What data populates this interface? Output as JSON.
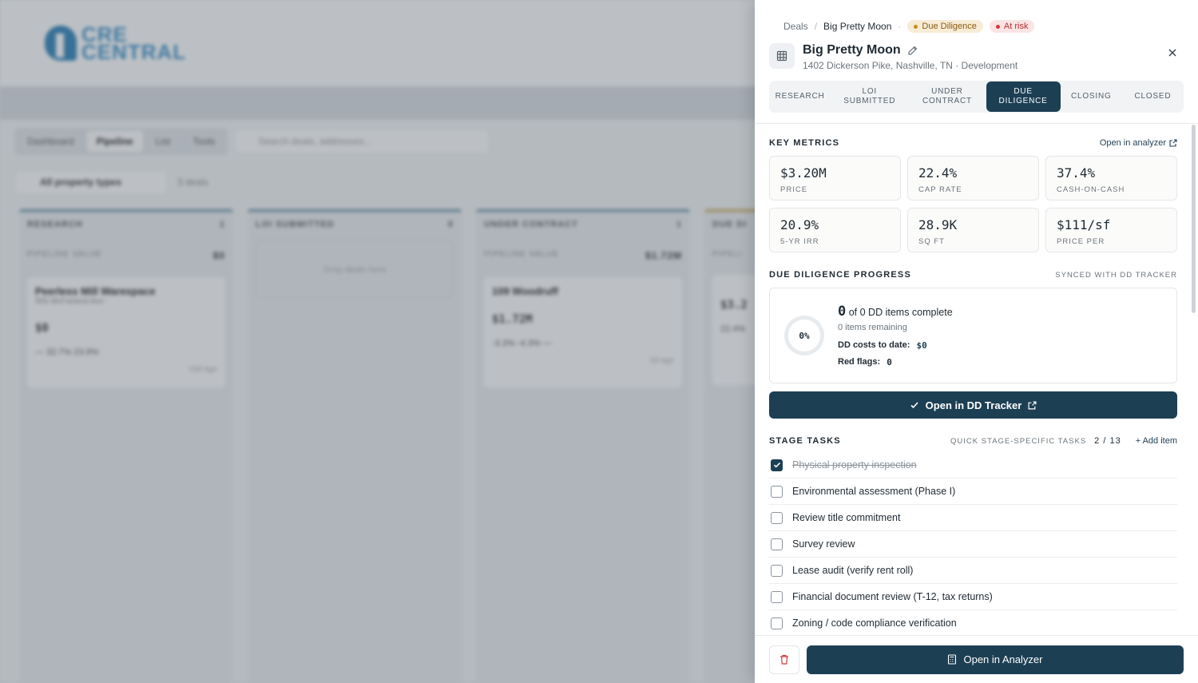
{
  "background": {
    "logo": {
      "line1": "CRE",
      "line2": "CENTRAL"
    },
    "view_tabs": [
      "Dashboard",
      "Pipeline",
      "List",
      "Tools"
    ],
    "active_view": "Pipeline",
    "search_placeholder": "Search deals, addresses...",
    "filter_label": "All property types",
    "deal_count": "3 deals",
    "columns": [
      {
        "name": "RESEARCH",
        "count": "1",
        "value_label": "PIPELINE VALUE",
        "value": "$0",
        "card": {
          "name": "Peerless Mill Warespace",
          "address": "555 McFarland Ave",
          "price": "$0",
          "metrics": "—   32.7%   23.9%",
          "age": "13d ago"
        }
      },
      {
        "name": "LOI SUBMITTED",
        "count": "0",
        "drop_text": "Drop deals here"
      },
      {
        "name": "UNDER CONTRACT",
        "count": "1",
        "value_label": "PIPELINE VALUE",
        "value": "$1.72M",
        "card": {
          "name": "109 Woodruff",
          "address": "",
          "price": "$1.72M",
          "metrics": "-3.3%   -4.3%   —",
          "age": "2d ago"
        }
      },
      {
        "name": "DUE DI",
        "count": "",
        "value_label": "PIPELI",
        "value": "",
        "card": {
          "name": "",
          "address": "",
          "price": "$3.2",
          "metrics": "22.4%",
          "age": ""
        }
      }
    ]
  },
  "drawer": {
    "breadcrumb": {
      "root": "Deals",
      "current": "Big Pretty Moon"
    },
    "badges": {
      "stage": "Due Diligence",
      "risk": "At risk"
    },
    "title": "Big Pretty Moon",
    "subtitle": "1402 Dickerson Pike, Nashville, TN · Development",
    "stages": [
      {
        "label": "RESEARCH",
        "active": false
      },
      {
        "label": "LOI SUBMITTED",
        "active": false
      },
      {
        "label": "UNDER CONTRACT",
        "active": false
      },
      {
        "label": "DUE DILIGENCE",
        "active": true
      },
      {
        "label": "CLOSING",
        "active": false
      },
      {
        "label": "CLOSED",
        "active": false
      }
    ],
    "key_metrics": {
      "title": "KEY METRICS",
      "link": "Open in analyzer",
      "items": [
        {
          "value": "$3.20M",
          "label": "PRICE"
        },
        {
          "value": "22.4%",
          "label": "CAP RATE"
        },
        {
          "value": "37.4%",
          "label": "CASH-ON-CASH"
        },
        {
          "value": "20.9%",
          "label": "5-YR IRR"
        },
        {
          "value": "28.9K",
          "label": "SQ FT"
        },
        {
          "value": "$111/sf",
          "label": "PRICE PER"
        }
      ]
    },
    "dd_progress": {
      "title": "DUE DILIGENCE PROGRESS",
      "sync": "SYNCED WITH DD TRACKER",
      "percent": "0%",
      "complete_num": "0",
      "complete_text": "of 0 DD items complete",
      "remaining": "0 items remaining",
      "costs_label": "DD costs to date:",
      "costs_value": "$0",
      "flags_label": "Red flags:",
      "flags_value": "0",
      "button": "Open in DD Tracker"
    },
    "stage_tasks": {
      "title": "STAGE TASKS",
      "subtitle": "QUICK STAGE-SPECIFIC TASKS",
      "count": "2 / 13",
      "add": "+ Add item",
      "items": [
        {
          "label": "Physical property inspection",
          "done": true
        },
        {
          "label": "Environmental assessment (Phase I)",
          "done": false
        },
        {
          "label": "Review title commitment",
          "done": false
        },
        {
          "label": "Survey review",
          "done": false
        },
        {
          "label": "Lease audit (verify rent roll)",
          "done": false
        },
        {
          "label": "Financial document review (T-12, tax returns)",
          "done": false
        },
        {
          "label": "Zoning / code compliance verification",
          "done": false
        }
      ]
    },
    "footer": {
      "analyzer": "Open in Analyzer"
    },
    "colors": {
      "primary": "#1d3f54",
      "warn": "#c98a1e",
      "danger": "#d23b3b"
    }
  }
}
